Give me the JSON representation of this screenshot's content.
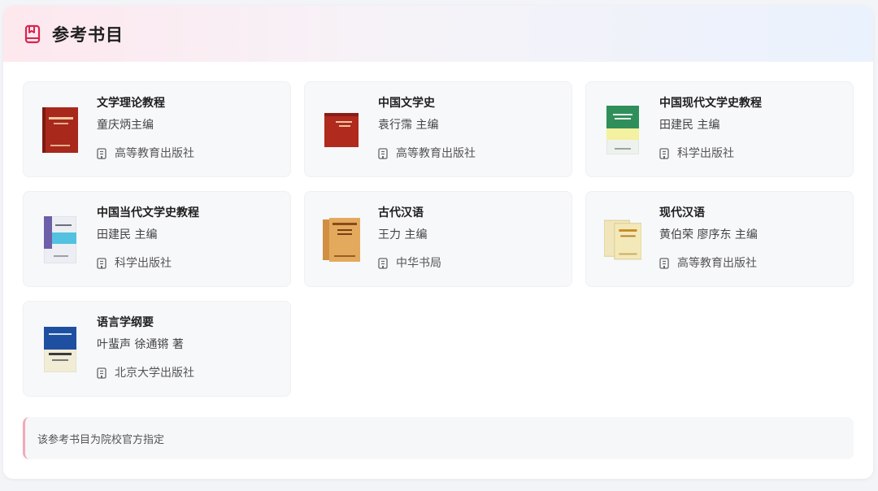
{
  "header": {
    "title": "参考书目",
    "icon": "book-icon",
    "accent": "#d6264f"
  },
  "books": [
    {
      "title": "文学理论教程",
      "author": "童庆炳主编",
      "publisher": "高等教育出版社",
      "cover_color": "#a8281c"
    },
    {
      "title": "中国文学史",
      "author": "袁行霈 主编",
      "publisher": "高等教育出版社",
      "cover_color": "#b02a1e"
    },
    {
      "title": "中国现代文学史教程",
      "author": "田建民 主编",
      "publisher": "科学出版社",
      "cover_color": "#e9efe9"
    },
    {
      "title": "中国当代文学史教程",
      "author": "田建民 主编",
      "publisher": "科学出版社",
      "cover_color": "#e6e8ef"
    },
    {
      "title": "古代汉语",
      "author": "王力 主编",
      "publisher": "中华书局",
      "cover_color": "#e0a85c"
    },
    {
      "title": "现代汉语",
      "author": "黄伯荣 廖序东 主编",
      "publisher": "高等教育出版社",
      "cover_color": "#efe3b4"
    },
    {
      "title": "语言学纲要",
      "author": "叶蜚声 徐通锵 著",
      "publisher": "北京大学出版社",
      "cover_color": "#f1ecd6"
    }
  ],
  "publisher_icon": "building-icon",
  "note": {
    "text": "该参考书目为院校官方指定",
    "border_color": "#f3a9b6"
  }
}
